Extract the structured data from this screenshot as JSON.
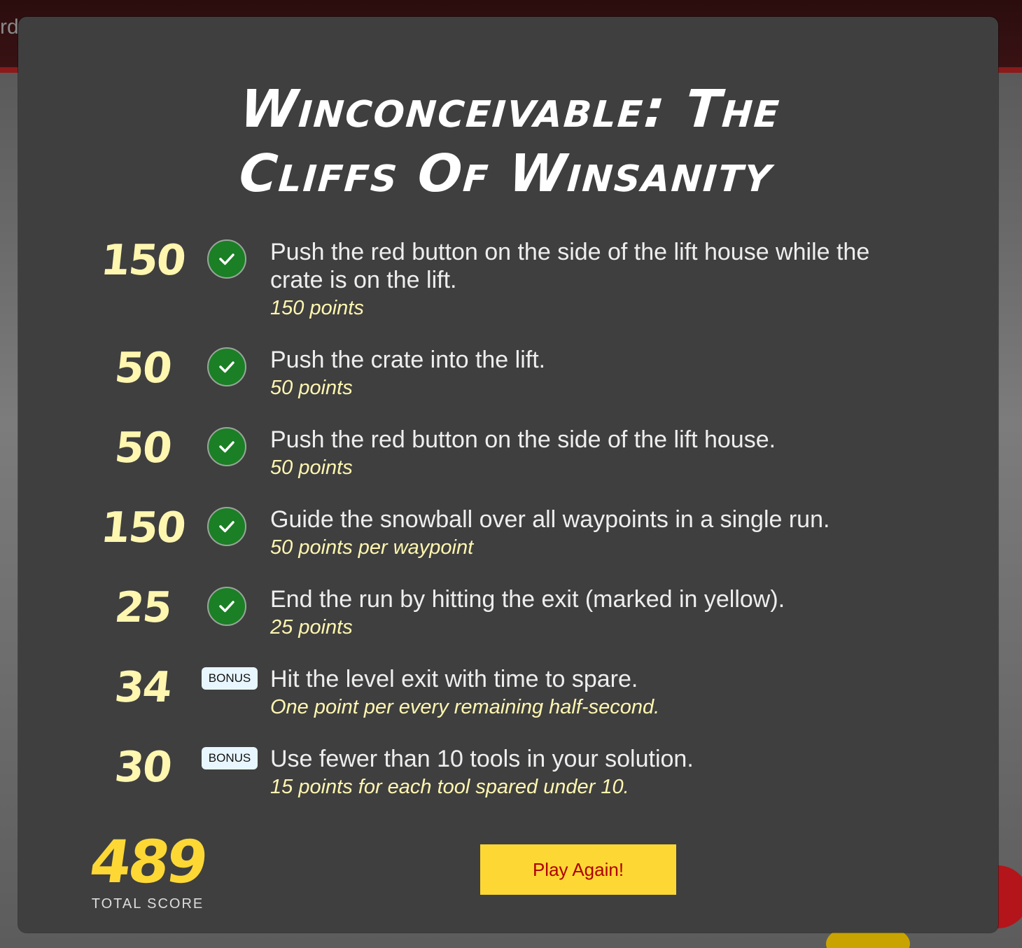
{
  "background": {
    "fragment_text": "rd"
  },
  "modal": {
    "title_line1": "Winconceivable: The",
    "title_line2": "Cliffs Of Winsanity",
    "goals": [
      {
        "score": "150",
        "status": "completed",
        "description": "Push the red button on the side of the lift house while the crate is on the lift.",
        "points_text": "150 points"
      },
      {
        "score": "50",
        "status": "completed",
        "description": "Push the crate into the lift.",
        "points_text": "50 points"
      },
      {
        "score": "50",
        "status": "completed",
        "description": "Push the red button on the side of the lift house.",
        "points_text": "50 points"
      },
      {
        "score": "150",
        "status": "completed",
        "description": "Guide the snowball over all waypoints in a single run.",
        "points_text": "50 points per waypoint"
      },
      {
        "score": "25",
        "status": "completed",
        "description": "End the run by hitting the exit (marked in yellow).",
        "points_text": "25 points"
      },
      {
        "score": "34",
        "status": "bonus",
        "badge": "BONUS",
        "description": "Hit the level exit with time to spare.",
        "points_text": "One point per every remaining half-second."
      },
      {
        "score": "30",
        "status": "bonus",
        "badge": "BONUS",
        "description": "Use fewer than 10 tools in your solution.",
        "points_text": "15 points for each tool spared under 10."
      }
    ],
    "total_score": "489",
    "total_label": "TOTAL SCORE",
    "play_again_label": "Play Again!"
  },
  "colors": {
    "modal_bg": "#3f3f3f",
    "score_text": "#fff6b0",
    "check_green": "#1a7f25",
    "total_yellow": "#fdd835",
    "button_text_red": "#b00000"
  }
}
